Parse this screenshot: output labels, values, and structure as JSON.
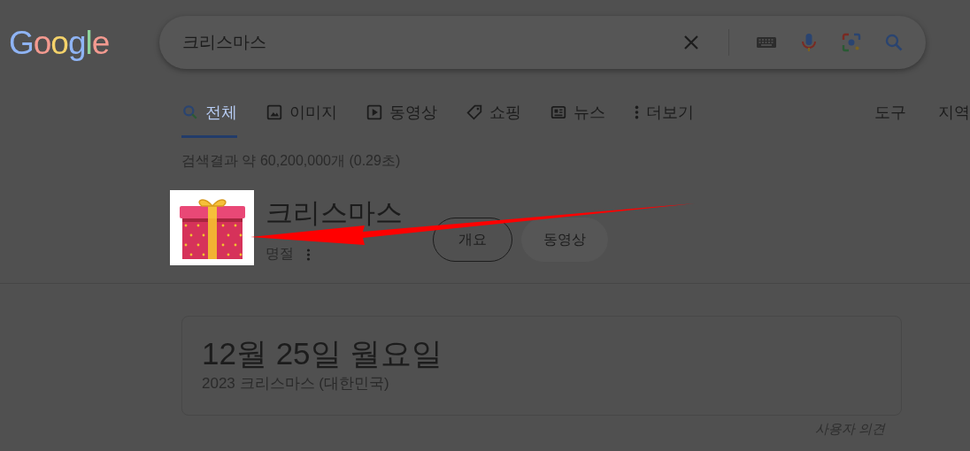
{
  "logo": {
    "text": "Google"
  },
  "search": {
    "value": "크리스마스"
  },
  "tabs": [
    {
      "kind": "search",
      "label": "전체",
      "selected": true
    },
    {
      "kind": "image",
      "label": "이미지",
      "selected": false
    },
    {
      "kind": "play",
      "label": "동영상",
      "selected": false
    },
    {
      "kind": "tag",
      "label": "쇼핑",
      "selected": false
    },
    {
      "kind": "news",
      "label": "뉴스",
      "selected": false
    },
    {
      "kind": "more",
      "label": "더보기",
      "selected": false
    }
  ],
  "tools": [
    "도구",
    "지역"
  ],
  "result_stats": "검색결과 약 60,200,000개 (0.29초)",
  "entity": {
    "title": "크리스마스",
    "subtitle": "명절",
    "chips": [
      {
        "label": "개요",
        "selected": true
      },
      {
        "label": "동영상",
        "selected": false
      }
    ]
  },
  "date_card": {
    "date": "12월 25일 월요일",
    "caption": "2023 크리스마스 (대한민국)"
  },
  "feedback": "사용자 의견"
}
